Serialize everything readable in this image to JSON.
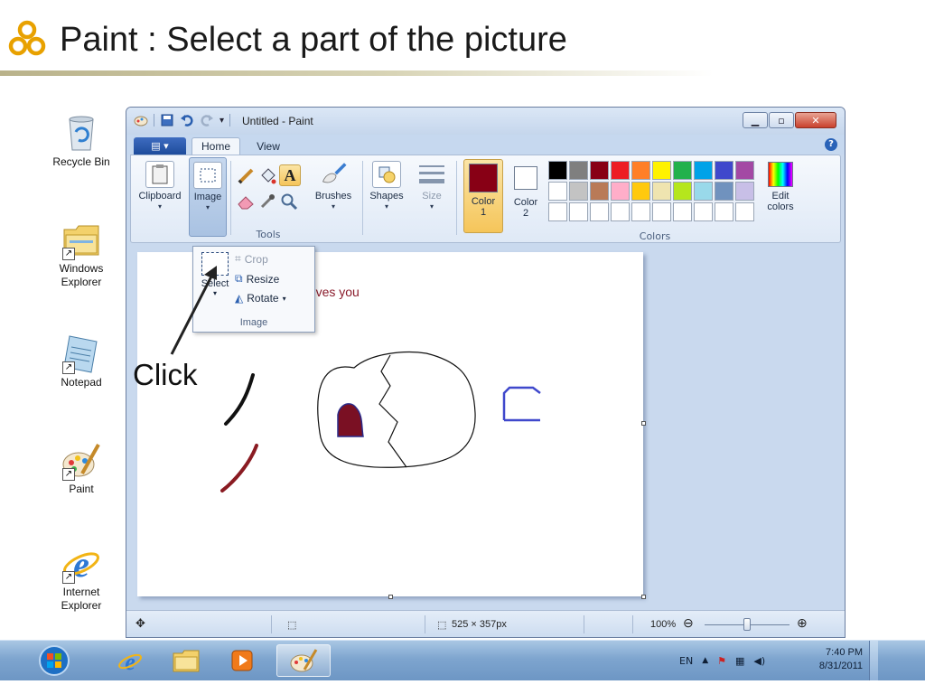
{
  "slide": {
    "title": "Paint : Select a part of the picture",
    "instruction": "Click"
  },
  "desktop_icons": [
    {
      "label": "Recycle Bin",
      "icon": "recycle-bin-icon"
    },
    {
      "label": "Windows Explorer",
      "icon": "folder-icon"
    },
    {
      "label": "Notepad",
      "icon": "notepad-icon"
    },
    {
      "label": "Paint",
      "icon": "paint-palette-icon"
    },
    {
      "label": "Internet Explorer",
      "icon": "internet-explorer-icon"
    }
  ],
  "window": {
    "title": "Untitled - Paint",
    "tabs": [
      "Home",
      "View"
    ]
  },
  "ribbon": {
    "clipboard": "Clipboard",
    "image": "Image",
    "tools_group": "Tools",
    "brushes": "Brushes",
    "shapes": "Shapes",
    "size": "Size",
    "color1_line1": "Color",
    "color1_line2": "1",
    "color2_line1": "Color",
    "color2_line2": "2",
    "edit_colors_line1": "Edit",
    "edit_colors_line2": "colors",
    "colors_group": "Colors",
    "palette_row1": [
      "#000000",
      "#7f7f7f",
      "#880015",
      "#ed1c24",
      "#ff7f27",
      "#fff200",
      "#22b14c",
      "#00a2e8",
      "#3f48cc",
      "#a349a4"
    ],
    "palette_row2": [
      "#ffffff",
      "#c3c3c3",
      "#b97a57",
      "#ffaec9",
      "#ffc90e",
      "#efe4b0",
      "#b5e61d",
      "#99d9ea",
      "#7092be",
      "#c8bfe7"
    ],
    "color1_value": "#880015",
    "color2_value": "#ffffff"
  },
  "image_dropdown": {
    "select": "Select",
    "crop": "Crop",
    "resize": "Resize",
    "rotate": "Rotate",
    "group_label": "Image"
  },
  "canvas": {
    "text": "us loves you"
  },
  "statusbar": {
    "dimensions": "525 × 357px",
    "zoom": "100%",
    "zoom_level": 1.0
  },
  "taskbar": {
    "language": "EN",
    "time": "7:40 PM",
    "date": "8/31/2011"
  }
}
